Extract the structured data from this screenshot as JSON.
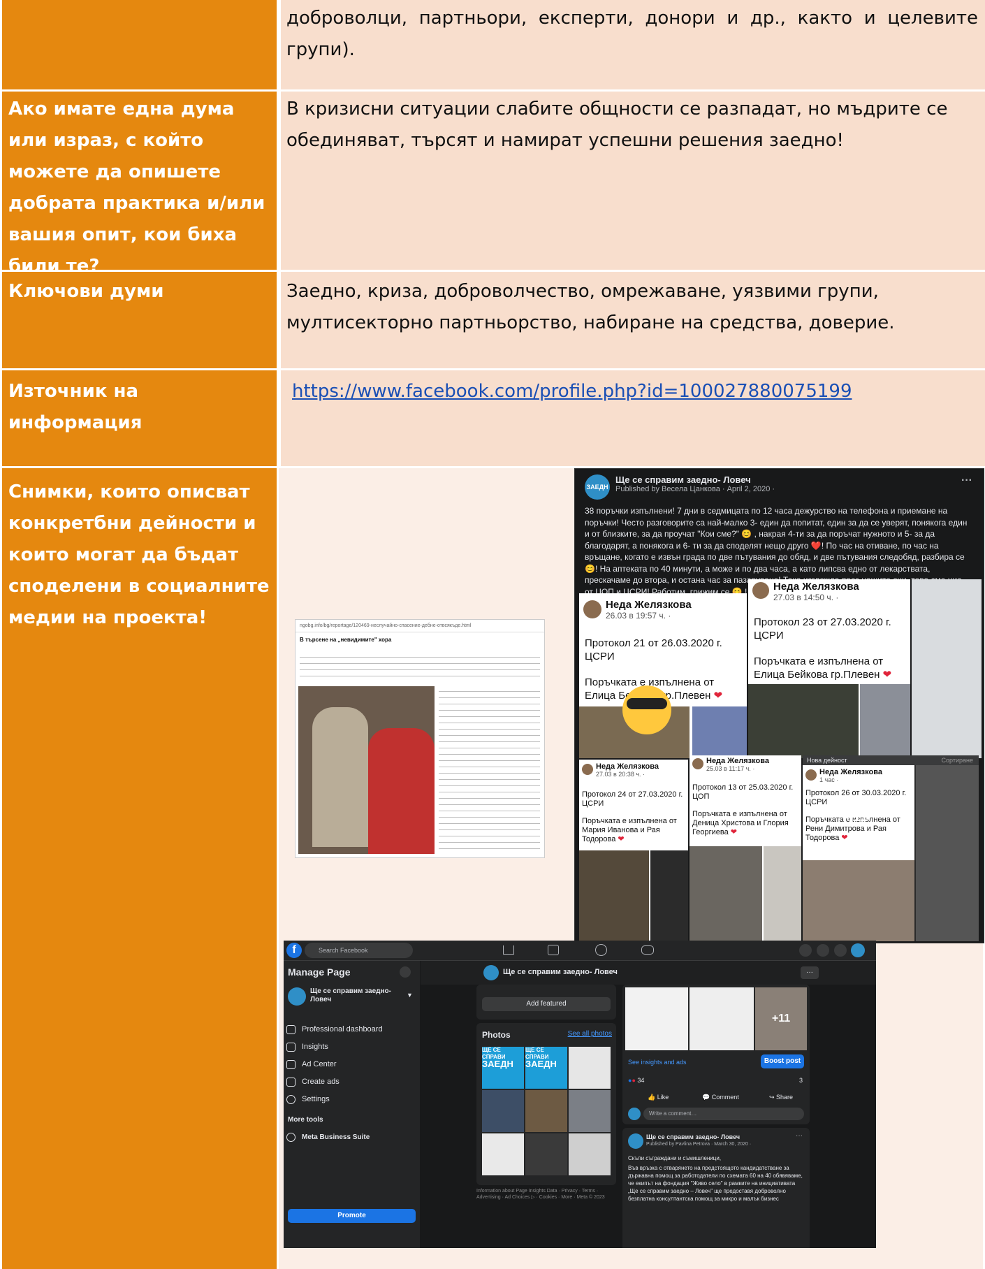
{
  "rows": [
    {
      "right": "доброволци, партньори, експерти, донори и др., както и целевите групи)."
    },
    {
      "left": "Ако имате една дума или израз, с който можете да опишете добрата практика и/или вашия опит, кои биха били те?",
      "right": "В кризисни ситуации слабите общности се разпадат, но мъдрите се обединяват, търсят и намират успешни решения заедно!"
    },
    {
      "left": "Ключови думи",
      "right": "Заедно, криза, доброволчество, омрежаване, уязвими групи, мултисекторно партньорство, набиране на средства, доверие."
    },
    {
      "left": "Източник на информация",
      "right": "https://www.facebook.com/profile.php?id=100027880075199"
    },
    {
      "left": "Снимки, които описват конкретбни дейности и които могат да бъдат споделени в социалните медии на проекта!"
    }
  ],
  "fb_post": {
    "page_name": "Ще се справим заедно- Ловеч",
    "published": "Published by Весела Цанкова · April 2, 2020 ·",
    "avatar_text": "ЗАЕДН",
    "more": "···",
    "text": "38 поръчки изпълнени! 7 дни в седмицата по 12 часа дежурство на телефона и приемане на поръчки! Често разговорите са най-малко 3- един да попитат, един за да се уверят, понякога един и от близките, за да проучат \"Кои сме?\" 😊 , накрая 4-ти за да поръчат нужното и 5- за да благодарят, а понякога и 6- ти за да споделят нещо друго ❤️! По час на отиване, по час на връщане, когато е извън града по две пътувания до обяд, и две пътувания следобяд, разбира се 😊! На аптеката по 40 минути, а може и по два часа, а като липсва едно от лекарствата, прескачаме до втора, и остана час за пазаруване! Така изглежда през нашите очи, това сме ние от ЦОП и ЦСРИ! Работим, грижим се 😊 !"
  },
  "cards": [
    {
      "name": "Неда Желязкова",
      "date": "26.03 в 19:57 ч. · ",
      "text1": "Протокол 21 от 26.03.2020 г.",
      "text2": "ЦСРИ",
      "text3": "Поръчката е изпълнена от Елица Бейкова гр.Плевен"
    },
    {
      "name": "Неда Желязкова",
      "date": "27.03 в 14:50 ч. · ",
      "text1": "Протокол 23 от 27.03.2020 г.",
      "text2": "ЦСРИ",
      "text3": "Поръчката е изпълнена от Елица Бейкова гр.Плевен"
    },
    {
      "name": "Неда Желязкова",
      "date": "27.03 в 20:38 ч. · ",
      "text1": "Протокол 24 от 27.03.2020 г.",
      "text2": "ЦСРИ",
      "text3": "Поръчката е изпълнена от Мария Иванова и Рая Тодорова"
    },
    {
      "name": "Неда Желязкова",
      "date": "25.03 в 11:17 ч. · ",
      "text1": "Протокол 13 от 25.03.2020 г. ЦОП",
      "text3": "Поръчката е изпълнена от Деница Христова и Глория Георгиева"
    },
    {
      "name": "Неда Желязкова",
      "date": "1 час · ",
      "text1": "Протокол 26 от 30.03.2020 г.",
      "text2": "ЦСРИ",
      "text3": "Поръчката е изпълнена от Рени Димитрова и Рая Тодорова",
      "header_left": "Нова дейност",
      "header_right": "Сортиране",
      "overlay": "+11"
    }
  ],
  "news": {
    "url": "ngobg.info/bg/reportage/120469-неслучайно-спасение-дебне-отвсякъде.html",
    "title": "В търсене на „невидимите\" хора"
  },
  "fb2": {
    "search": "Search Facebook",
    "manage": "Manage Page",
    "page_name": "Ще се справим заедно- Ловеч",
    "menu": [
      "Professional dashboard",
      "Insights",
      "Ad Center",
      "Create ads",
      "Settings"
    ],
    "more_tools": "More tools",
    "mbs": "Meta Business Suite",
    "promote": "Promote",
    "add_featured": "Add featured",
    "photos": "Photos",
    "see_all": "See all photos",
    "footer": "Information about Page Insights Data · Privacy · Terms · Advertising · Ad Choices ▷ · Cookies · More · Meta © 2023",
    "insights": "See insights and ads",
    "boost": "Boost post",
    "reactions": "34",
    "shares": "3",
    "like": "Like",
    "comment": "Comment",
    "share": "Share",
    "write": "Write a comment…",
    "post2_name": "Ще се справим заедно- Ловеч",
    "post2_pub": "Published by Pavlina Petrova · March 30, 2020 ·",
    "post2_text1": "Скъпи съграждани и съмишленици,",
    "post2_text2": "Във връзка с отварянето на предстоящото кандидатстване за държавна помощ за работодатели по схемата 60 на 40 обявяваме, че екипът на фондация \"Живо село\" в рамките на инициативата „Ще се справим заедно – Ловеч\" ще предоставя доброволно безплатна консултантска помощ за микро и малък бизнес",
    "plus": "+11",
    "photo_label": "ЩЕ СЕ СПРАВИ",
    "photo_label2": "ЗАЕДН"
  }
}
